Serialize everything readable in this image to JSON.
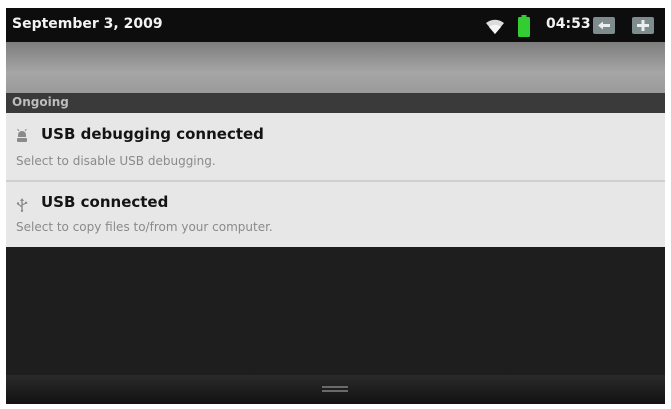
{
  "status_bar": {
    "date": "September 3, 2009",
    "time": "04:53",
    "icons": [
      "wifi-icon",
      "battery-icon",
      "back-key-icon",
      "menu-key-icon"
    ],
    "battery_color": "#33cc33"
  },
  "ongoing": {
    "header": "Ongoing"
  },
  "notifications": [
    {
      "icon": "usb-debugging-icon",
      "title": "USB debugging connected",
      "subtitle": "Select to disable USB debugging."
    },
    {
      "icon": "usb-icon",
      "title": "USB connected",
      "subtitle": "Select to copy files to/from your computer."
    }
  ]
}
